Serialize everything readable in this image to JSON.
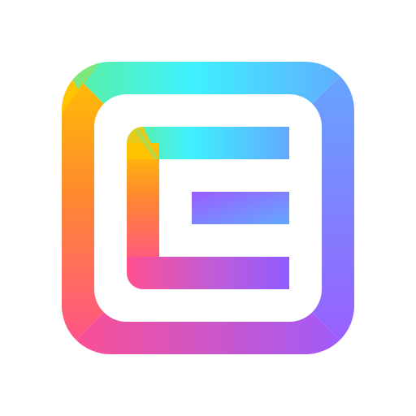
{
  "icon": {
    "name": "app-logo-e",
    "colors": {
      "background": "#ffffff",
      "green": "#5ef09a",
      "cyan": "#3ef0ff",
      "blue": "#63a8ff",
      "violet": "#9b5cff",
      "purple": "#8f5cff",
      "pink": "#ff4f8f",
      "orange": "#ff8a2e",
      "yellow": "#ffc400"
    }
  }
}
